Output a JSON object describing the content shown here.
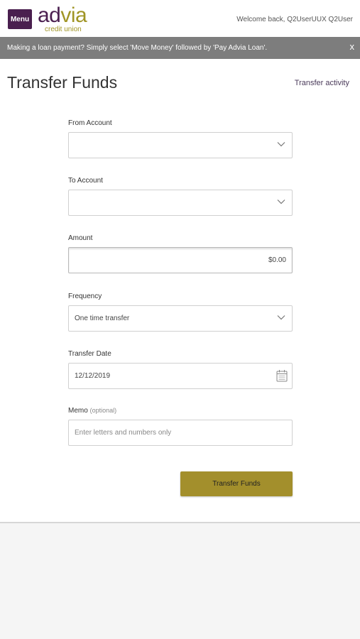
{
  "header": {
    "menu_label": "Menu",
    "logo_ad": "ad",
    "logo_via": "via",
    "logo_sub": "credit union",
    "welcome": "Welcome back, Q2UserUUX Q2User"
  },
  "banner": {
    "message": "Making a loan payment? Simply select 'Move Money' followed by 'Pay Advia Loan'.",
    "close": "x"
  },
  "page": {
    "title": "Transfer Funds",
    "activity_link": "Transfer activity"
  },
  "form": {
    "from_account": {
      "label": "From Account",
      "value": ""
    },
    "to_account": {
      "label": "To Account",
      "value": ""
    },
    "amount": {
      "label": "Amount",
      "value": "$0.00"
    },
    "frequency": {
      "label": "Frequency",
      "value": "One time transfer"
    },
    "transfer_date": {
      "label": "Transfer Date",
      "value": "12/12/2019"
    },
    "memo": {
      "label": "Memo",
      "optional": "(optional)",
      "placeholder": "Enter letters and numbers only"
    },
    "submit_label": "Transfer Funds"
  },
  "colors": {
    "brand_purple": "#4a1f4f",
    "brand_gold": "#a38f2c",
    "banner_gray": "#7d7d7d"
  },
  "icons": {
    "dropdown": "chevron-down-icon",
    "calendar": "calendar-icon",
    "close": "close-icon"
  }
}
